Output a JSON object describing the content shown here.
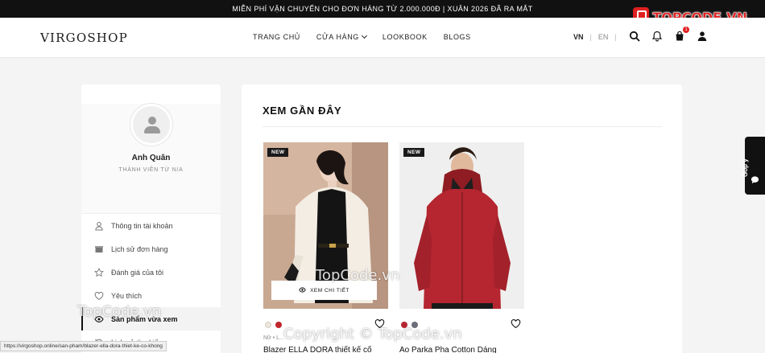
{
  "promo_bar": {
    "text": "MIỄN PHÍ VẬN CHUYỂN CHO ĐƠN HÀNG TỪ 2.000.000Đ | XUÂN 2026 ĐÃ RA MẮT"
  },
  "brand_badge": {
    "text": "TOPCODE.VN"
  },
  "header": {
    "logo": "VIRGOSHOP",
    "nav": [
      {
        "label": "TRANG CHỦ"
      },
      {
        "label": "CỬA HÀNG",
        "has_dropdown": true
      },
      {
        "label": "LOOKBOOK"
      },
      {
        "label": "BLOGS"
      }
    ],
    "lang_active": "VN",
    "lang_other": "EN",
    "lang_separator": "|",
    "icons": [
      "search-icon",
      "bell-icon",
      "cart-icon",
      "user-icon"
    ],
    "cart_count": "1"
  },
  "profile": {
    "name": "Anh Quân",
    "member_since": "THÀNH VIÊN TỪ N/A"
  },
  "account_menu": [
    {
      "label": "Thông tin tài khoản",
      "icon": "user-outline-icon"
    },
    {
      "label": "Lịch sử đơn hàng",
      "icon": "box-icon"
    },
    {
      "label": "Đánh giá của tôi",
      "icon": "star-icon"
    },
    {
      "label": "Yêu thích",
      "icon": "heart-icon"
    },
    {
      "label": "Sản phẩm vừa xem",
      "icon": "eye-icon",
      "active": true
    },
    {
      "label": "Lịch sử tìm kiếm",
      "icon": "history-icon"
    }
  ],
  "recent": {
    "title": "XEM GẦN ĐÂY",
    "products": [
      {
        "badge": "NEW",
        "quick_view": "XEM CHI TIẾT",
        "swatches": [
          "#ece7da",
          "#c0272d"
        ],
        "meta": "Nữ • L...",
        "name": "Blazer ELLA DORA thiết kế cổ"
      },
      {
        "badge": "NEW",
        "swatches": [
          "#b52630",
          "#6b6e78"
        ],
        "meta": "",
        "name": "Áo Parka Pha Cotton Dáng"
      }
    ]
  },
  "feedback_tab": {
    "label": "Góp ý"
  },
  "status_url": "https://virgoshop.online/san-pham/blazer-ella-dora-thiet-ke-co-khong",
  "watermarks": {
    "center": "TopCode.vn",
    "left": "TopCode.vn",
    "copyright": "Copyright © TopCode.vn"
  },
  "colors": {
    "promo_bg": "#111111",
    "accent_red": "#e02020",
    "page_bg": "#f4f4f4"
  }
}
